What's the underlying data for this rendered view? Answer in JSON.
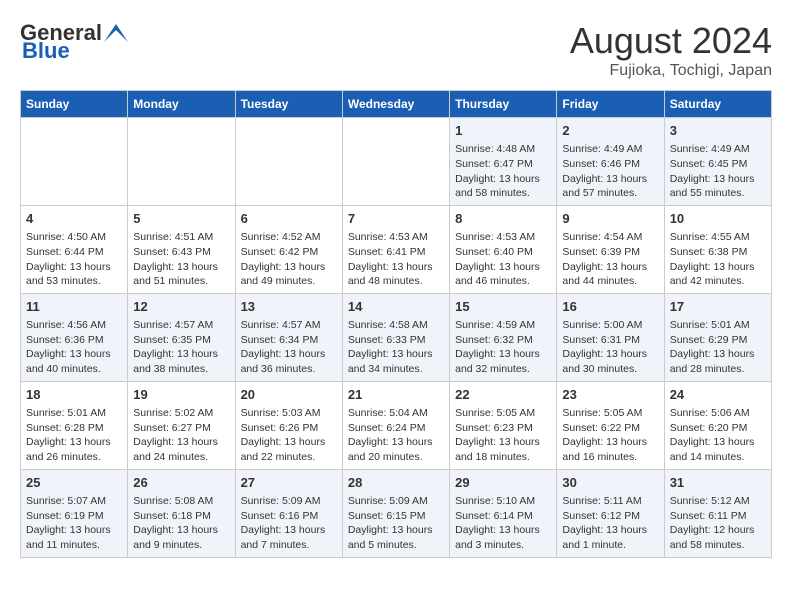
{
  "header": {
    "logo_line1": "General",
    "logo_line2": "Blue",
    "title": "August 2024",
    "subtitle": "Fujioka, Tochigi, Japan"
  },
  "days_of_week": [
    "Sunday",
    "Monday",
    "Tuesday",
    "Wednesday",
    "Thursday",
    "Friday",
    "Saturday"
  ],
  "weeks": [
    [
      {
        "day": "",
        "content": ""
      },
      {
        "day": "",
        "content": ""
      },
      {
        "day": "",
        "content": ""
      },
      {
        "day": "",
        "content": ""
      },
      {
        "day": "1",
        "content": "Sunrise: 4:48 AM\nSunset: 6:47 PM\nDaylight: 13 hours\nand 58 minutes."
      },
      {
        "day": "2",
        "content": "Sunrise: 4:49 AM\nSunset: 6:46 PM\nDaylight: 13 hours\nand 57 minutes."
      },
      {
        "day": "3",
        "content": "Sunrise: 4:49 AM\nSunset: 6:45 PM\nDaylight: 13 hours\nand 55 minutes."
      }
    ],
    [
      {
        "day": "4",
        "content": "Sunrise: 4:50 AM\nSunset: 6:44 PM\nDaylight: 13 hours\nand 53 minutes."
      },
      {
        "day": "5",
        "content": "Sunrise: 4:51 AM\nSunset: 6:43 PM\nDaylight: 13 hours\nand 51 minutes."
      },
      {
        "day": "6",
        "content": "Sunrise: 4:52 AM\nSunset: 6:42 PM\nDaylight: 13 hours\nand 49 minutes."
      },
      {
        "day": "7",
        "content": "Sunrise: 4:53 AM\nSunset: 6:41 PM\nDaylight: 13 hours\nand 48 minutes."
      },
      {
        "day": "8",
        "content": "Sunrise: 4:53 AM\nSunset: 6:40 PM\nDaylight: 13 hours\nand 46 minutes."
      },
      {
        "day": "9",
        "content": "Sunrise: 4:54 AM\nSunset: 6:39 PM\nDaylight: 13 hours\nand 44 minutes."
      },
      {
        "day": "10",
        "content": "Sunrise: 4:55 AM\nSunset: 6:38 PM\nDaylight: 13 hours\nand 42 minutes."
      }
    ],
    [
      {
        "day": "11",
        "content": "Sunrise: 4:56 AM\nSunset: 6:36 PM\nDaylight: 13 hours\nand 40 minutes."
      },
      {
        "day": "12",
        "content": "Sunrise: 4:57 AM\nSunset: 6:35 PM\nDaylight: 13 hours\nand 38 minutes."
      },
      {
        "day": "13",
        "content": "Sunrise: 4:57 AM\nSunset: 6:34 PM\nDaylight: 13 hours\nand 36 minutes."
      },
      {
        "day": "14",
        "content": "Sunrise: 4:58 AM\nSunset: 6:33 PM\nDaylight: 13 hours\nand 34 minutes."
      },
      {
        "day": "15",
        "content": "Sunrise: 4:59 AM\nSunset: 6:32 PM\nDaylight: 13 hours\nand 32 minutes."
      },
      {
        "day": "16",
        "content": "Sunrise: 5:00 AM\nSunset: 6:31 PM\nDaylight: 13 hours\nand 30 minutes."
      },
      {
        "day": "17",
        "content": "Sunrise: 5:01 AM\nSunset: 6:29 PM\nDaylight: 13 hours\nand 28 minutes."
      }
    ],
    [
      {
        "day": "18",
        "content": "Sunrise: 5:01 AM\nSunset: 6:28 PM\nDaylight: 13 hours\nand 26 minutes."
      },
      {
        "day": "19",
        "content": "Sunrise: 5:02 AM\nSunset: 6:27 PM\nDaylight: 13 hours\nand 24 minutes."
      },
      {
        "day": "20",
        "content": "Sunrise: 5:03 AM\nSunset: 6:26 PM\nDaylight: 13 hours\nand 22 minutes."
      },
      {
        "day": "21",
        "content": "Sunrise: 5:04 AM\nSunset: 6:24 PM\nDaylight: 13 hours\nand 20 minutes."
      },
      {
        "day": "22",
        "content": "Sunrise: 5:05 AM\nSunset: 6:23 PM\nDaylight: 13 hours\nand 18 minutes."
      },
      {
        "day": "23",
        "content": "Sunrise: 5:05 AM\nSunset: 6:22 PM\nDaylight: 13 hours\nand 16 minutes."
      },
      {
        "day": "24",
        "content": "Sunrise: 5:06 AM\nSunset: 6:20 PM\nDaylight: 13 hours\nand 14 minutes."
      }
    ],
    [
      {
        "day": "25",
        "content": "Sunrise: 5:07 AM\nSunset: 6:19 PM\nDaylight: 13 hours\nand 11 minutes."
      },
      {
        "day": "26",
        "content": "Sunrise: 5:08 AM\nSunset: 6:18 PM\nDaylight: 13 hours\nand 9 minutes."
      },
      {
        "day": "27",
        "content": "Sunrise: 5:09 AM\nSunset: 6:16 PM\nDaylight: 13 hours\nand 7 minutes."
      },
      {
        "day": "28",
        "content": "Sunrise: 5:09 AM\nSunset: 6:15 PM\nDaylight: 13 hours\nand 5 minutes."
      },
      {
        "day": "29",
        "content": "Sunrise: 5:10 AM\nSunset: 6:14 PM\nDaylight: 13 hours\nand 3 minutes."
      },
      {
        "day": "30",
        "content": "Sunrise: 5:11 AM\nSunset: 6:12 PM\nDaylight: 13 hours\nand 1 minute."
      },
      {
        "day": "31",
        "content": "Sunrise: 5:12 AM\nSunset: 6:11 PM\nDaylight: 12 hours\nand 58 minutes."
      }
    ]
  ]
}
